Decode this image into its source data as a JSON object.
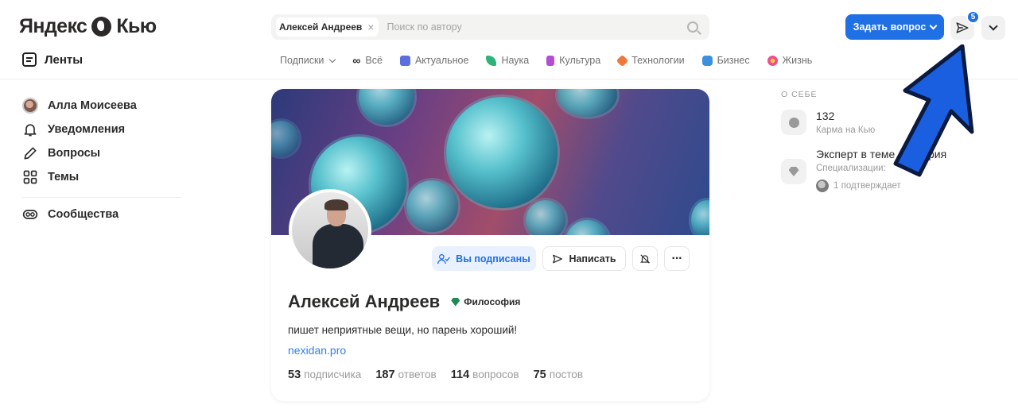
{
  "header": {
    "logo": "Яндекс Кью",
    "feeds_label": "Ленты",
    "search": {
      "chip_label": "Алексей Андреев",
      "chip_close": "×",
      "placeholder": "Поиск по автору"
    },
    "ask_button": "Задать вопрос",
    "messages_badge": "5"
  },
  "categories": [
    {
      "label": "Подписки",
      "color": "",
      "kind": "dropdown"
    },
    {
      "label": "Всё",
      "color": "",
      "kind": "infinity"
    },
    {
      "label": "Актуальное",
      "color": "#5b6fe0"
    },
    {
      "label": "Наука",
      "color": "#2fb37b"
    },
    {
      "label": "Культура",
      "color": "#b24ed6"
    },
    {
      "label": "Технологии",
      "color": "#f0783b"
    },
    {
      "label": "Бизнес",
      "color": "#3d8fe0"
    },
    {
      "label": "Жизнь",
      "color": "#ef4e8b"
    }
  ],
  "sidebar": {
    "items": [
      {
        "label": "Алла Моисеева",
        "icon": "user-avatar"
      },
      {
        "label": "Уведомления",
        "icon": "bell-icon"
      },
      {
        "label": "Вопросы",
        "icon": "pencil-icon"
      },
      {
        "label": "Темы",
        "icon": "grid-icon"
      },
      {
        "label": "Сообщества",
        "icon": "community-icon"
      }
    ]
  },
  "profile": {
    "subscribed_label": "Вы подписаны",
    "write_label": "Написать",
    "more_label": "···",
    "name": "Алексей Андреев",
    "topic": "Философия",
    "bio": "пишет неприятные вещи, но парень хороший!",
    "site": "nexidan.pro",
    "stats": [
      {
        "value": "53",
        "label": "подписчика"
      },
      {
        "value": "187",
        "label": "ответов"
      },
      {
        "value": "114",
        "label": "вопросов"
      },
      {
        "value": "75",
        "label": "постов"
      }
    ]
  },
  "about": {
    "heading": "О СЕБЕ",
    "karma_value": "132",
    "karma_label": "Карма на Кью",
    "expert_title": "Эксперт в теме",
    "expert_title_tail": "фия",
    "expert_sub": "Специализации:",
    "confirm_label": "1 подтверждает"
  }
}
